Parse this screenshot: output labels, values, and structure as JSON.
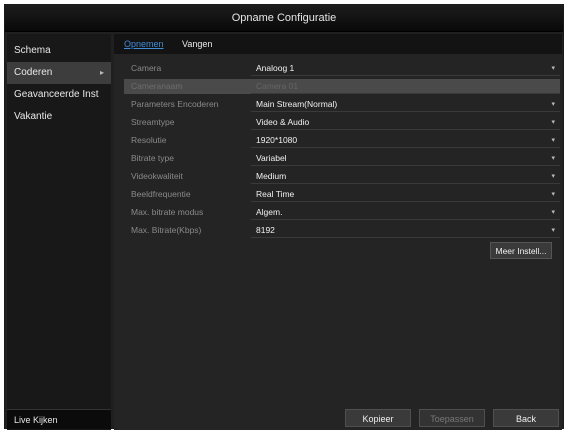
{
  "window": {
    "title": "Opname Configuratie"
  },
  "sidebar": {
    "items": [
      {
        "label": "Schema"
      },
      {
        "label": "Coderen",
        "arrow": "▸"
      },
      {
        "label": "Geavanceerde Inst"
      },
      {
        "label": "Vakantie"
      }
    ],
    "live_view": "Live Kijken"
  },
  "tabs": [
    {
      "label": "Opnemen",
      "active": true
    },
    {
      "label": "Vangen",
      "active": false
    }
  ],
  "form": {
    "rows": [
      {
        "label": "Camera",
        "value": "Analoog 1",
        "caret": "▾"
      },
      {
        "label": "Cameranaam",
        "value": "Camera 01"
      },
      {
        "label": "Parameters Encoderen",
        "value": "Main Stream(Normal)",
        "caret": "▾"
      },
      {
        "label": "Streamtype",
        "value": "Video & Audio",
        "caret": "▾"
      },
      {
        "label": "Resolutie",
        "value": "1920*1080",
        "caret": "▾"
      },
      {
        "label": "Bitrate type",
        "value": "Variabel",
        "caret": "▾"
      },
      {
        "label": "Videokwaliteit",
        "value": "Medium",
        "caret": "▾"
      },
      {
        "label": "Beeldfrequentie",
        "value": "Real Time",
        "caret": "▾"
      },
      {
        "label": "Max. bitrate modus",
        "value": "Algem.",
        "caret": "▾"
      },
      {
        "label": "Max. Bitrate(Kbps)",
        "value": "8192",
        "caret": "▾"
      }
    ],
    "more_settings": "Meer Instell..."
  },
  "buttons": {
    "copy": "Kopieer",
    "apply": "Toepassen",
    "back": "Back"
  },
  "colors": {
    "background": "#202020",
    "sidebar_active": "#3d3d3d",
    "tab_active": "#3f8cd9"
  }
}
